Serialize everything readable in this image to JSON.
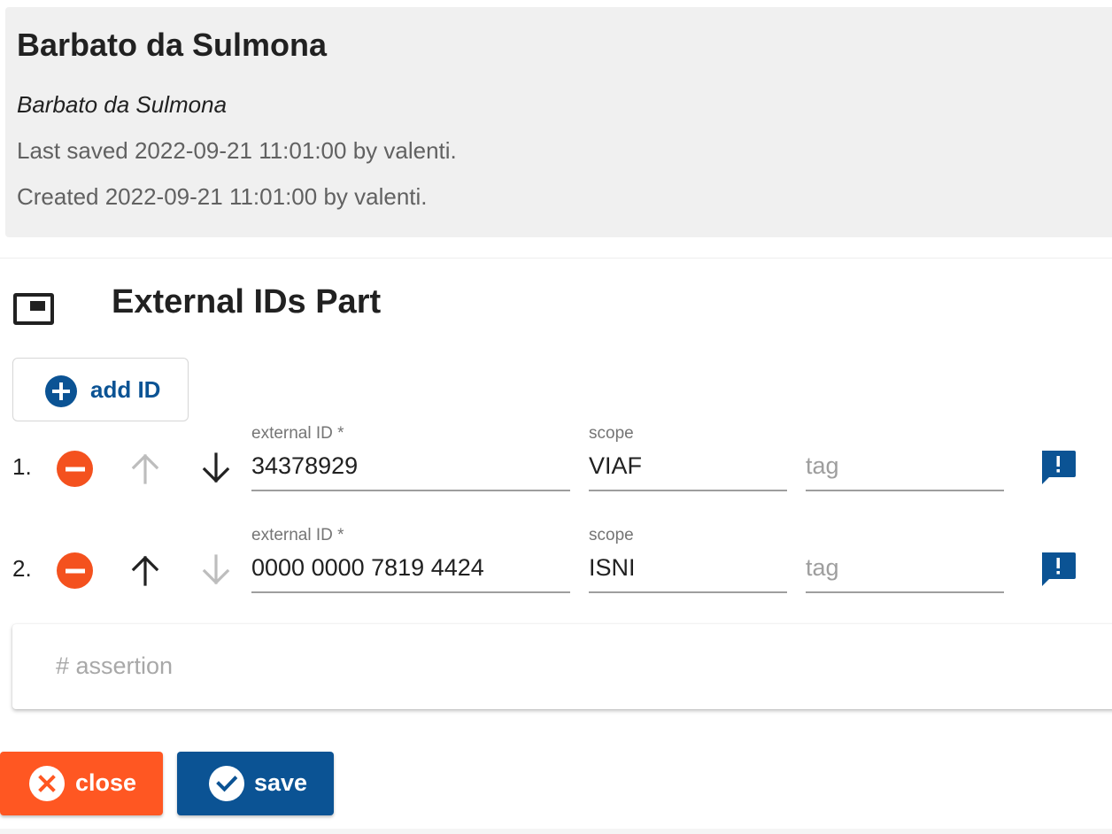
{
  "header": {
    "title": "Barbato da Sulmona",
    "subtitle": "Barbato da Sulmona",
    "last_saved": "Last saved 2022-09-21 11:01:00 by valenti.",
    "created": "Created 2022-09-21 11:01:00 by valenti."
  },
  "part": {
    "title": "External IDs Part",
    "add_label": "add ID"
  },
  "ids": [
    {
      "number": "1.",
      "external_id_label": "external ID *",
      "external_id": "34378929",
      "scope_label": "scope",
      "scope": "VIAF",
      "tag_placeholder": "tag",
      "move_up_enabled": false,
      "move_down_enabled": true
    },
    {
      "number": "2.",
      "external_id_label": "external ID *",
      "external_id": "0000 0000 7819 4424",
      "scope_label": "scope",
      "scope": "ISNI",
      "tag_placeholder": "tag",
      "move_up_enabled": true,
      "move_down_enabled": false
    }
  ],
  "assertion": {
    "placeholder": "# assertion"
  },
  "footer": {
    "close_label": "close",
    "save_label": "save"
  },
  "colors": {
    "primary": "#0b5394",
    "danger": "#f4511e",
    "close": "#ff5722",
    "disabled": "#bdbdbd"
  }
}
